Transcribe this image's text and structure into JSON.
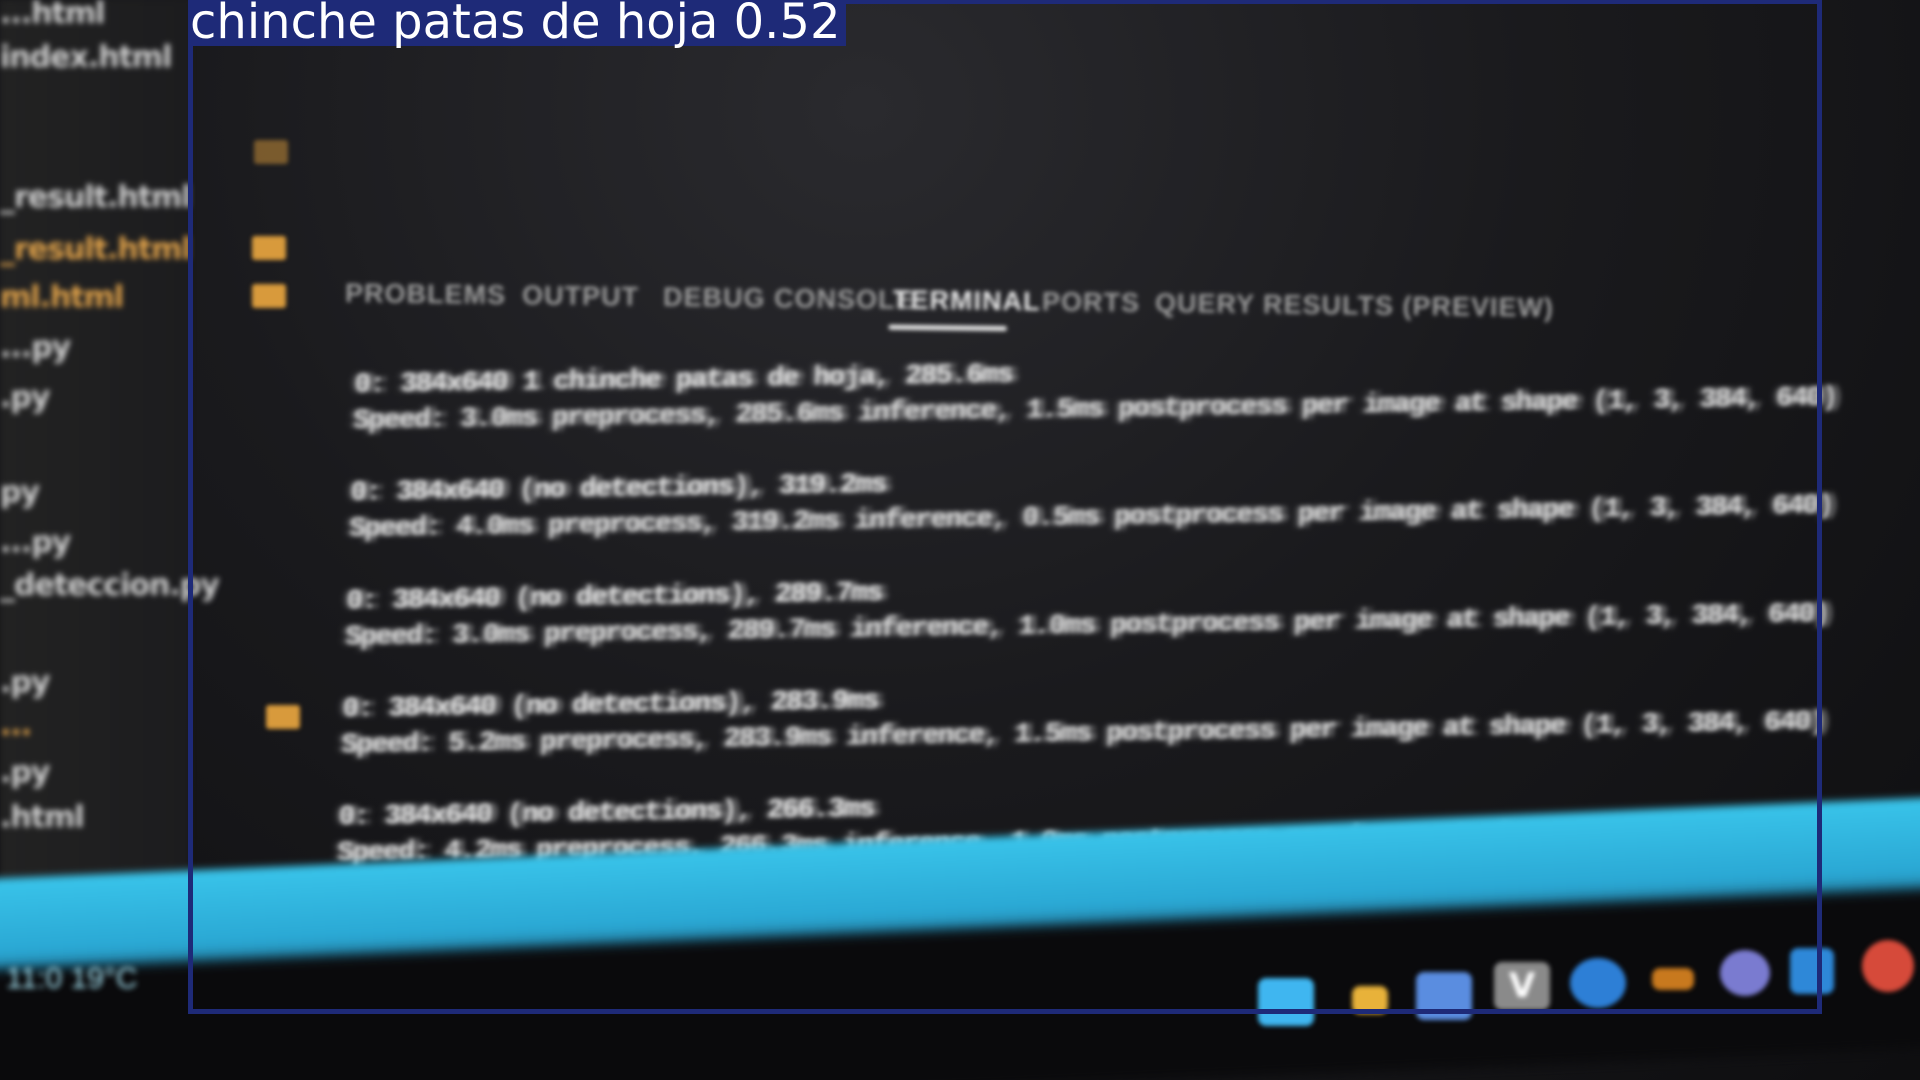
{
  "detection": {
    "label": "chinche patas de hoja 0.52",
    "box_color": "#1e2a78",
    "label_text_color": "#ffffff"
  },
  "explorer": {
    "items": [
      "...html",
      "index.html",
      "_result.html",
      "ml.html",
      "...py",
      ".py",
      "py",
      "...py",
      "...py",
      "_deteccion.py",
      "...",
      ".py",
      "...",
      ".py",
      ".html"
    ],
    "folder_color": "#d89a3c"
  },
  "panel": {
    "tabs": [
      "PROBLEMS",
      "OUTPUT",
      "DEBUG CONSOLE",
      "TERMINAL",
      "PORTS",
      "QUERY RESULTS (PREVIEW)"
    ],
    "active_tab": "TERMINAL"
  },
  "terminal": {
    "lines": [
      "0: 384x640 1 chinche patas de hoja, 285.6ms",
      "Speed: 3.0ms preprocess, 285.6ms inference, 1.5ms postprocess per image at shape (1, 3, 384, 640)",
      "0: 384x640 (no detections), 319.2ms",
      "Speed: 4.0ms preprocess, 319.2ms inference, 0.5ms postprocess per image at shape (1, 3, 384, 640)",
      "0: 384x640 (no detections), 289.7ms",
      "Speed: 3.0ms preprocess, 289.7ms inference, 1.0ms postprocess per image at shape (1, 3, 384, 640)",
      "0: 384x640 (no detections), 283.9ms",
      "Speed: 5.2ms preprocess, 283.9ms inference, 1.5ms postprocess per image at shape (1, 3, 384, 640)",
      "0: 384x640 (no detections), 266.3ms",
      "Speed: 4.2ms preprocess, 266.3ms inference, 1.0ms postprocess per image at shape (1, 3, 384, 640)"
    ]
  },
  "taskbar": {
    "accent": "#39c4ea",
    "status_text": "11:0  19°C",
    "icons": [
      {
        "name": "windows-start-icon",
        "color": "#3fb6f0",
        "glyph": ""
      },
      {
        "name": "file-explorer-icon",
        "color": "#e8b23a",
        "glyph": ""
      },
      {
        "name": "copilot-icon",
        "color": "#5a8de0",
        "glyph": ""
      },
      {
        "name": "v-app-icon",
        "color": "#8a8a8a",
        "glyph": "V"
      },
      {
        "name": "edge-browser-icon",
        "color": "#2d7fd6",
        "glyph": ""
      },
      {
        "name": "app-orange-icon",
        "color": "#c8791e",
        "glyph": ""
      },
      {
        "name": "app-circle-icon",
        "color": "#7a7bd0",
        "glyph": ""
      },
      {
        "name": "vscode-icon",
        "color": "#2e88d8",
        "glyph": ""
      },
      {
        "name": "chrome-icon",
        "color": "#d64a3a",
        "glyph": ""
      }
    ]
  }
}
